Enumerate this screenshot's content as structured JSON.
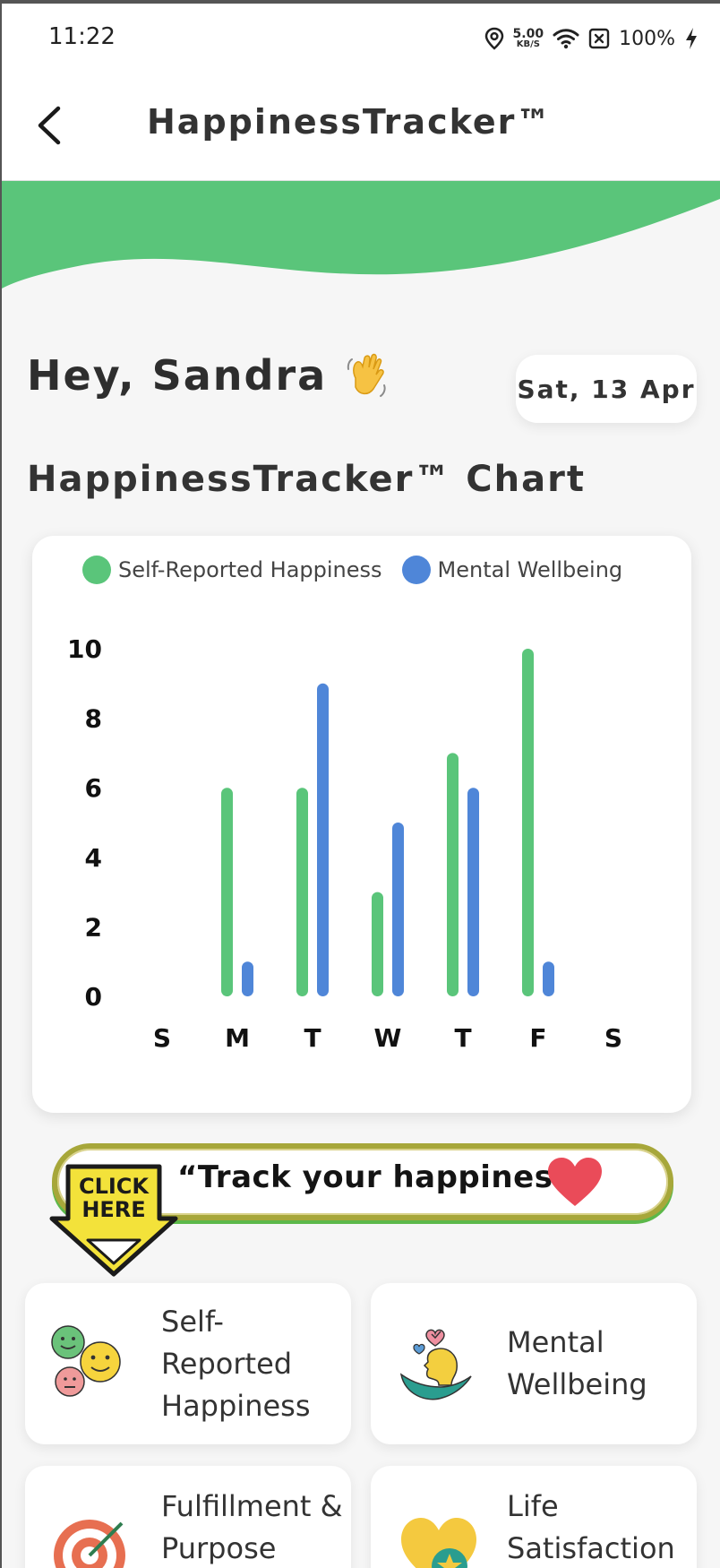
{
  "status_bar": {
    "time": "11:22",
    "net_speed_value": "5.00",
    "net_speed_unit": "KB/S",
    "battery": "100%"
  },
  "app_bar": {
    "title": "HappinessTracker™"
  },
  "greeting": {
    "text": "Hey, Sandra",
    "date": "Sat, 13 Apr"
  },
  "chart_heading": "HappinessTracker™ Chart",
  "chart_data": {
    "type": "bar",
    "categories": [
      "S",
      "M",
      "T",
      "W",
      "T",
      "F",
      "S"
    ],
    "series": [
      {
        "name": "Self-Reported Happiness",
        "color": "#5ac57a",
        "values": [
          null,
          6,
          6,
          3,
          7,
          10,
          null
        ]
      },
      {
        "name": "Mental Wellbeing",
        "color": "#4f86d8",
        "values": [
          null,
          1,
          9,
          5,
          6,
          1,
          null
        ]
      }
    ],
    "yticks": [
      "0",
      "2",
      "4",
      "6",
      "8",
      "10"
    ],
    "ylim": [
      0,
      10
    ],
    "legend": "top",
    "grid": false
  },
  "banner": {
    "text": "“Track your happiness.",
    "click_line1": "CLICK",
    "click_line2": "HERE"
  },
  "features": [
    {
      "label_lines": [
        "Self-",
        "Reported",
        "Happiness"
      ],
      "icon": "smiley-faces-icon"
    },
    {
      "label_lines": [
        "Mental",
        "Wellbeing"
      ],
      "icon": "mental-wellbeing-icon"
    },
    {
      "label_lines": [
        "Fulfillment &",
        "Purpose"
      ],
      "icon": "target-icon"
    },
    {
      "label_lines": [
        "Life",
        "Satisfaction"
      ],
      "icon": "heart-star-icon"
    }
  ],
  "colors": {
    "accent_green": "#5ac57a",
    "accent_blue": "#4f86d8"
  }
}
